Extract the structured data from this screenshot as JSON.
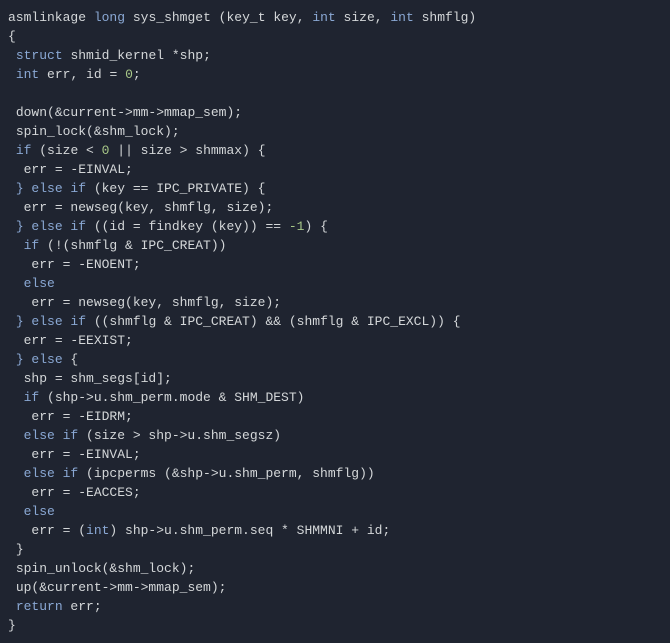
{
  "code": {
    "line1_asmlinkage": "asmlinkage",
    "line1_long": "long",
    "line1_fn": "sys_shmget",
    "line1_p1t": "key_t",
    "line1_p1n": "key",
    "line1_int": "int",
    "line1_size": "size",
    "line1_shmflg": "shmflg",
    "line2_brace": "{",
    "line3_struct": "struct",
    "line3_type": "shmid_kernel",
    "line3_var": "*shp;",
    "line4_int": "int",
    "line4_err": "err",
    "line4_id": "id",
    "line4_eq": "=",
    "line4_zero": "0",
    "line4_semi": ";",
    "line6": "down(&current->mm->mmap_sem);",
    "line7": "spin_lock(&shm_lock);",
    "line8_if": "if",
    "line8_cond": "(size < ",
    "line8_zero": "0",
    "line8_or": " || size > shmmax) {",
    "line9": "err = -EINVAL;",
    "line10_else": "} else if",
    "line10_cond": " (key == IPC_PRIVATE) {",
    "line11": "err = newseg(key, shmflg, size);",
    "line12_else": "} else if",
    "line12_cond": " ((id = findkey (key)) == ",
    "line12_neg1": "-1",
    "line12_end": ") {",
    "line13_if": "if",
    "line13_cond": " (!(shmflg & IPC_CREAT))",
    "line14": "err = -ENOENT;",
    "line15_else": "else",
    "line16": "err = newseg(key, shmflg, size);",
    "line17_else": "} else if",
    "line17_cond": " ((shmflg & IPC_CREAT) && (shmflg & IPC_EXCL)) {",
    "line18": "err = -EEXIST;",
    "line19_else": "} else",
    "line19_brace": " {",
    "line20": "shp = shm_segs[id];",
    "line21_if": "if",
    "line21_cond": " (shp->u.shm_perm.mode & SHM_DEST)",
    "line22": "err = -EIDRM;",
    "line23_else": "else if",
    "line23_cond": " (size > shp->u.shm_segsz)",
    "line24": "err = -EINVAL;",
    "line25_else": "else if",
    "line25_cond": " (ipcperms (&shp->u.shm_perm, shmflg))",
    "line26": "err = -EACCES;",
    "line27_else": "else",
    "line28_a": "err = (",
    "line28_int": "int",
    "line28_b": ") shp->u.shm_perm.seq * SHMMNI + id;",
    "line29": "}",
    "line30": "spin_unlock(&shm_lock);",
    "line31": "up(&current->mm->mmap_sem);",
    "line32_return": "return",
    "line32_err": " err;",
    "line33": "}"
  }
}
